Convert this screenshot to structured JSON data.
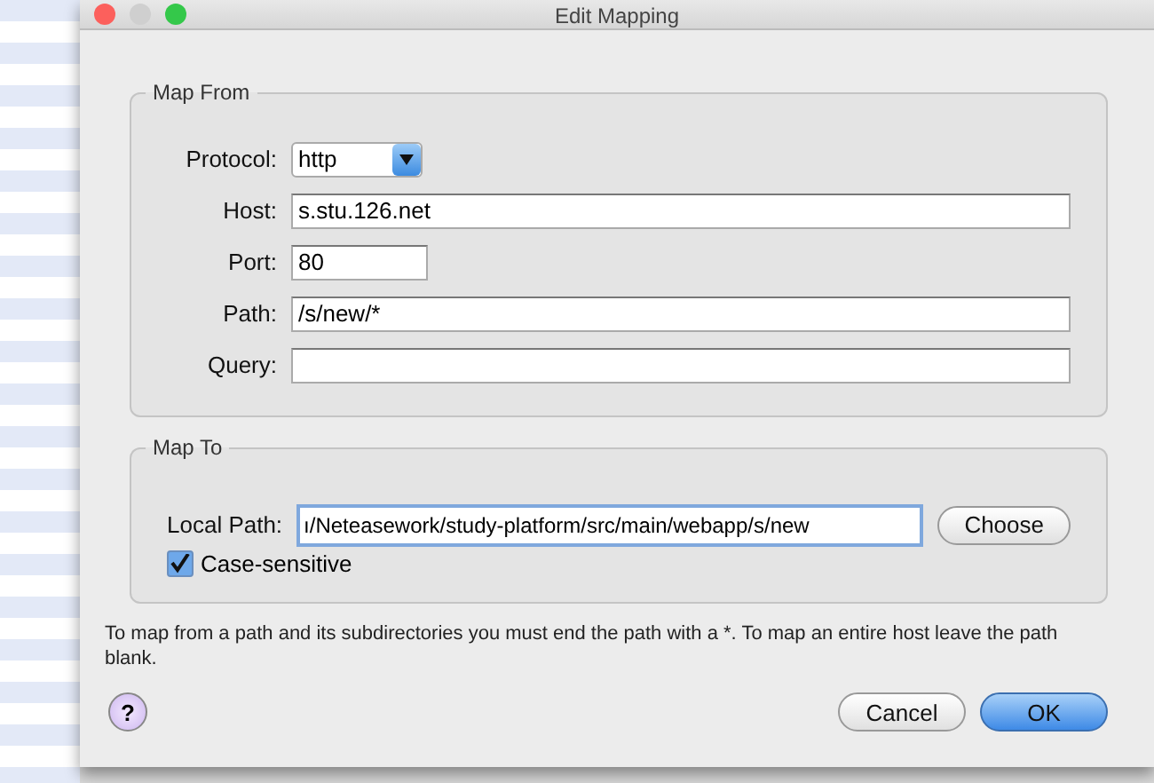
{
  "window": {
    "title": "Edit Mapping"
  },
  "map_from": {
    "legend": "Map From",
    "fields": [
      {
        "kind": "select",
        "label": "Protocol:",
        "value": "http"
      },
      {
        "kind": "text",
        "label": "Host:",
        "value": "s.stu.126.net"
      },
      {
        "kind": "short",
        "label": "Port:",
        "value": "80"
      },
      {
        "kind": "text",
        "label": "Path:",
        "value": "/s/new/*"
      },
      {
        "kind": "text",
        "label": "Query:"
      }
    ]
  },
  "map_to": {
    "legend": "Map To",
    "local_path": {
      "label": "Local Path:",
      "value": "ı/Neteasework/study-platform/src/main/webapp/s/new"
    },
    "choose_button": "Choose",
    "case_sensitive": {
      "label": "Case-sensitive",
      "checked": true
    }
  },
  "hint": "To map from a path and its subdirectories you must end the path with a *. To map an entire host leave the path blank.",
  "help_button": "?",
  "buttons": [
    {
      "label": "Cancel",
      "kind": "normal"
    },
    {
      "label": "OK",
      "kind": "default"
    }
  ]
}
